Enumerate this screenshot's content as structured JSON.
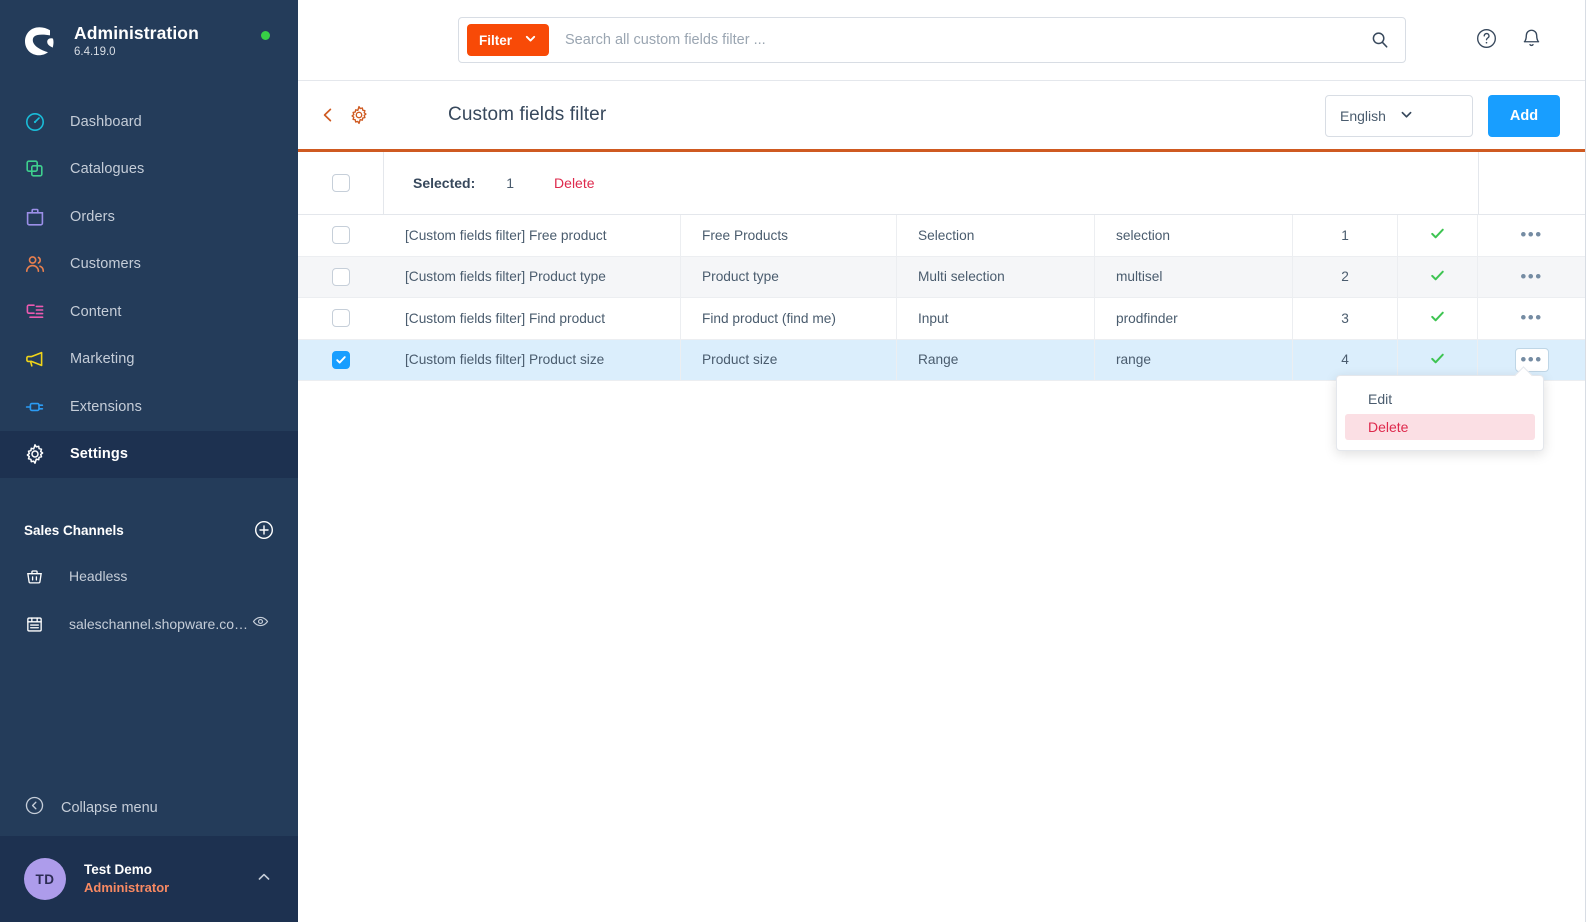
{
  "sidebar": {
    "brand": {
      "title": "Administration",
      "version": "6.4.19.0",
      "logo_icon": "shopware-logo-icon",
      "status_icon": "status-online-dot"
    },
    "nav": [
      {
        "label": "Dashboard",
        "icon": "dashboard-icon",
        "color": "#1abcd8",
        "active": false
      },
      {
        "label": "Catalogues",
        "icon": "catalogue-icon",
        "color": "#3ecf8e",
        "active": false
      },
      {
        "label": "Orders",
        "icon": "orders-icon",
        "color": "#9b8fe8",
        "active": false
      },
      {
        "label": "Customers",
        "icon": "customers-icon",
        "color": "#e9804f",
        "active": false
      },
      {
        "label": "Content",
        "icon": "content-icon",
        "color": "#ec5ab0",
        "active": false
      },
      {
        "label": "Marketing",
        "icon": "marketing-icon",
        "color": "#f0d419",
        "active": false
      },
      {
        "label": "Extensions",
        "icon": "extensions-icon",
        "color": "#2b9cf5",
        "active": false
      },
      {
        "label": "Settings",
        "icon": "settings-gear-icon",
        "color": "#ffffff",
        "active": true
      }
    ],
    "sales_channels": {
      "title": "Sales Channels",
      "add_icon": "plus-circle-icon",
      "items": [
        {
          "label": "Headless",
          "icon": "basket-icon",
          "has_eye": false
        },
        {
          "label": "saleschannel.shopware.co…",
          "icon": "storefront-icon",
          "has_eye": true,
          "eye_icon": "eye-icon"
        }
      ]
    },
    "collapse": {
      "label": "Collapse menu",
      "icon": "collapse-left-icon"
    },
    "user": {
      "initials": "TD",
      "name": "Test Demo",
      "role": "Administrator",
      "caret_icon": "chevron-up-icon"
    }
  },
  "topbar": {
    "filter_button": {
      "label": "Filter",
      "icon": "chevron-down-icon"
    },
    "search": {
      "value": "",
      "placeholder": "Search all custom fields filter ...",
      "icon": "search-icon"
    },
    "help_icon": "help-circle-icon",
    "notifications_icon": "bell-icon"
  },
  "page_header": {
    "back_icon": "chevron-left-icon",
    "gear_icon": "settings-gear-icon",
    "title": "Custom fields filter",
    "language": {
      "selected": "English",
      "icon": "chevron-down-icon"
    },
    "add_button": "Add"
  },
  "table": {
    "bulk": {
      "label": "Selected:",
      "count": "1",
      "delete_label": "Delete"
    },
    "header_checkbox_checked": false,
    "rows": [
      {
        "checked": false,
        "name": "[Custom fields filter] Free product",
        "label": "Free Products",
        "type": "Selection",
        "technical": "selection",
        "position": "1",
        "active": true,
        "menu_open": false
      },
      {
        "checked": false,
        "name": "[Custom fields filter] Product type",
        "label": "Product type",
        "type": "Multi selection",
        "technical": "multisel",
        "position": "2",
        "active": true,
        "menu_open": false
      },
      {
        "checked": false,
        "name": "[Custom fields filter] Find product",
        "label": "Find product (find me)",
        "type": "Input",
        "technical": "prodfinder",
        "position": "3",
        "active": true,
        "menu_open": false
      },
      {
        "checked": true,
        "name": "[Custom fields filter] Product size",
        "label": "Product size",
        "type": "Range",
        "technical": "range",
        "position": "4",
        "active": true,
        "menu_open": true
      }
    ],
    "active_icon": "check-icon",
    "actions_icon": "ellipsis-icon"
  },
  "context_menu": {
    "items": [
      {
        "label": "Edit",
        "danger": false
      },
      {
        "label": "Delete",
        "danger": true
      }
    ]
  },
  "colors": {
    "sidebar_bg": "#243c5a",
    "sidebar_active": "#1d3150",
    "accent_orange": "#f84a07",
    "table_top_rule": "#cf5a21",
    "primary_blue": "#189eff",
    "danger_red": "#de294c",
    "success_green": "#37d046"
  }
}
